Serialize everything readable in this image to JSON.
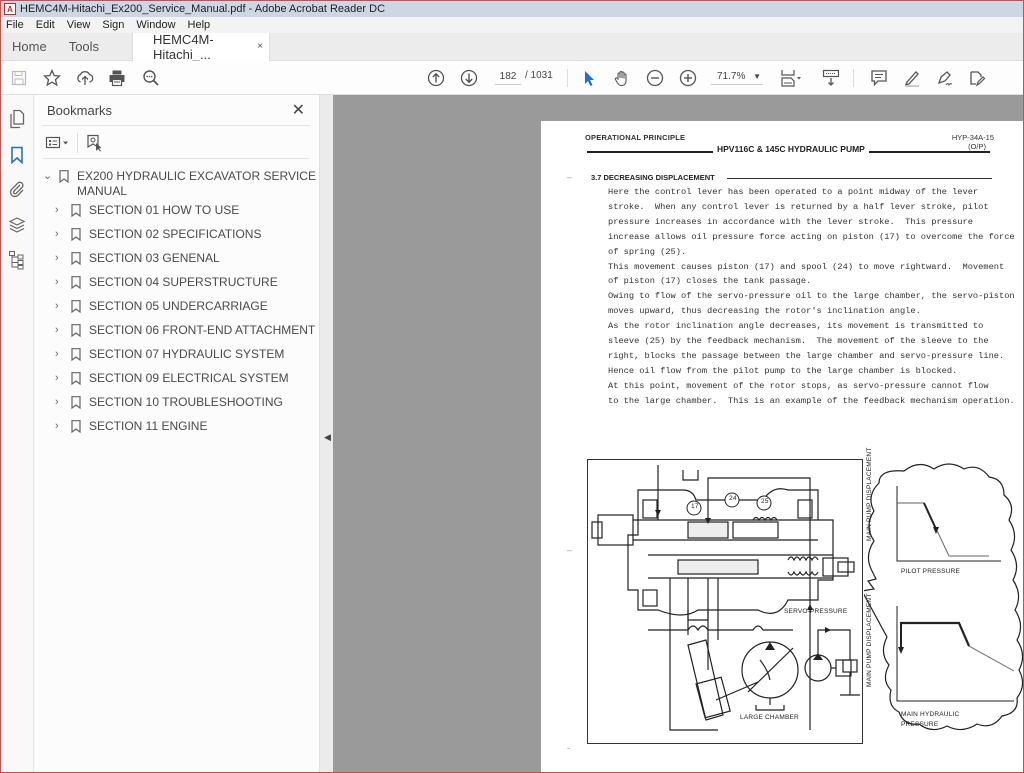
{
  "window": {
    "title": "HEMC4M-Hitachi_Ex200_Service_Manual.pdf - Adobe Acrobat Reader DC"
  },
  "menu": [
    "File",
    "Edit",
    "View",
    "Sign",
    "Window",
    "Help"
  ],
  "tabs": {
    "home": "Home",
    "tools": "Tools",
    "document": "HEMC4M-Hitachi_...",
    "close_glyph": "×"
  },
  "toolbar": {
    "current_page": "182",
    "total_pages": "/ 1031",
    "zoom": "71.7%",
    "icons": [
      "save-icon",
      "bookmark-star-icon",
      "upload-icon",
      "print-icon",
      "search-zoom-icon",
      "page-up-icon",
      "page-down-icon",
      "select-cursor-icon",
      "hand-icon",
      "zoom-out-icon",
      "zoom-in-icon",
      "page-fit-icon",
      "scroll-mode-icon",
      "comment-icon",
      "highlight-icon",
      "sign-icon",
      "fill-sign-icon"
    ]
  },
  "rail": {
    "icons": [
      "pages-icon",
      "bookmarks-icon",
      "attachments-icon",
      "layers-icon",
      "structure-icon"
    ]
  },
  "bookmarks": {
    "title": "Bookmarks",
    "close_glyph": "✕",
    "root": {
      "label_line1": "EX200 HYDRAULIC EXCAVATOR SERVICE",
      "label_line2": "MANUAL"
    },
    "items": [
      {
        "label": "SECTION 01 HOW TO USE"
      },
      {
        "label": "SECTION 02 SPECIFICATIONS"
      },
      {
        "label": "SECTION 03 GENENAL"
      },
      {
        "label": "SECTION 04 SUPERSTRUCTURE"
      },
      {
        "label": "SECTION 05 UNDERCARRIAGE"
      },
      {
        "label": "SECTION 06 FRONT-END ATTACHMENT"
      },
      {
        "label": "SECTION 07 HYDRAULIC SYSTEM"
      },
      {
        "label": "SECTION 09 ELECTRICAL SYSTEM"
      },
      {
        "label": "SECTION 10 TROUBLESHOOTING"
      },
      {
        "label": "SECTION 11 ENGINE"
      }
    ]
  },
  "document": {
    "header_left": "OPERATIONAL PRINCIPLE",
    "header_right_1": "HYP-34A-15",
    "header_right_2": "(O/P)",
    "title": "HPV116C & 145C  HYDRAULIC PUMP",
    "section": "3.7  DECREASING DISPLACEMENT",
    "body_lines": [
      "Here the control lever has been operated to a point midway of the lever",
      "stroke.  When any control lever is returned by a half lever stroke, pilot",
      "pressure increases in accordance with the lever stroke.  This pressure",
      "increase allows oil pressure force acting on piston (17) to overcome the force",
      "of spring (25).",
      "This movement causes piston (17) and spool (24) to move rightward.  Movement",
      "of piston (17) closes the tank passage.",
      "Owing to flow of the servo-pressure oil to the large chamber, the servo-piston",
      "moves upward, thus decreasing the rotor's inclination angle.",
      "As the rotor inclination angle decreases, its movement is transmitted to",
      "sleeve (25) by the feedback mechanism.  The movement of the sleeve to the",
      "right, blocks the passage between the large chamber and servo-pressure line.",
      "Hence oil flow from the pilot pump to the large chamber is blocked.",
      "At this point, movement of the rotor stops, as servo-pressure cannot flow",
      "to the large chamber.  This is an example of the feedback mechanism operation."
    ],
    "figure": {
      "callouts": [
        "17",
        "24",
        "25"
      ],
      "servo_label": "SERVO-PRESSURE",
      "chamber_label": "LARGE CHAMBER"
    },
    "graphs": {
      "top_ylabel": "MAIN PUMP DISPLACEMENT",
      "top_xlabel": "PILOT PRESSURE",
      "bottom_ylabel": "MAIN PUMP DISPLACEMENT",
      "bottom_xlabel_1": "MAIN HYDRAULIC",
      "bottom_xlabel_2": "PRESSURE"
    }
  }
}
